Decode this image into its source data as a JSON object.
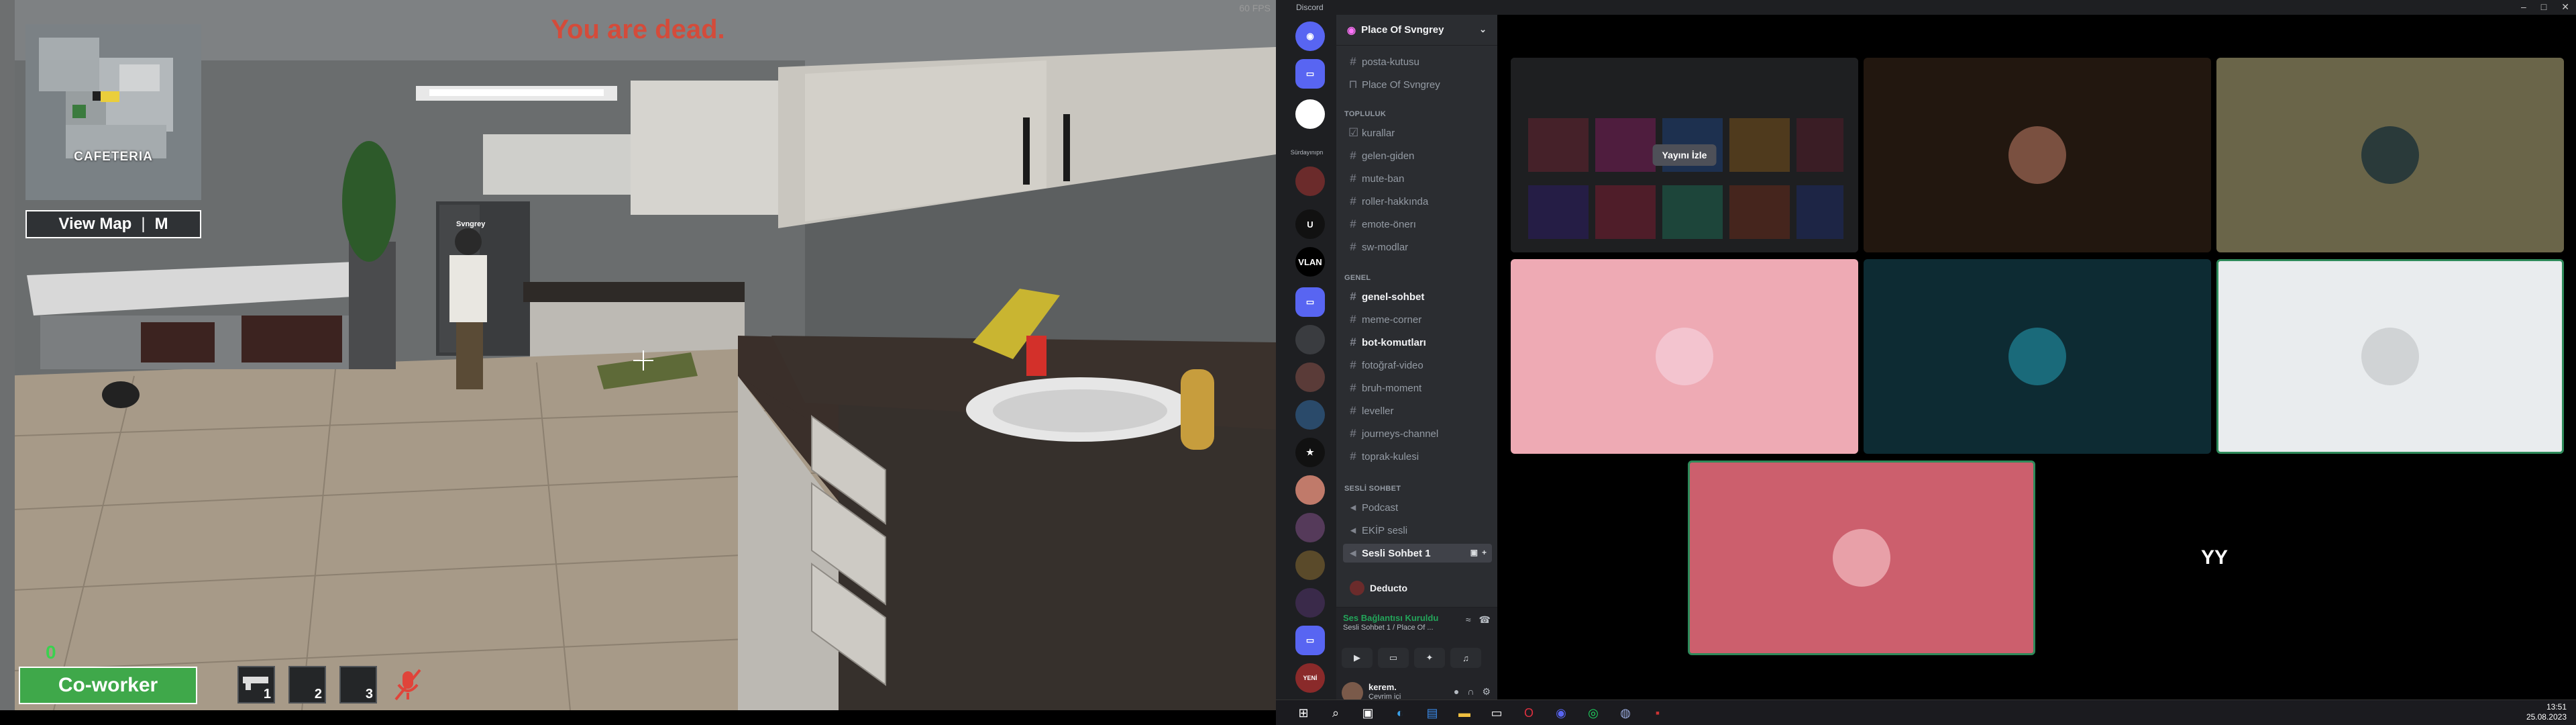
{
  "game": {
    "fps": "60 FPS",
    "death_message": "You are dead.",
    "minimap_label": "CAFETERIA",
    "view_map_label": "View Map",
    "view_map_key": "M",
    "nameplate": "Svngrey",
    "score": "0",
    "role": "Co-worker",
    "slots": [
      "1",
      "2",
      "3"
    ]
  },
  "discord": {
    "app_title": "Discord",
    "server_name": "Place Of Svngrey",
    "top_channels": [
      "posta-kutusu",
      "Place Of Svngrey"
    ],
    "categories": {
      "topluluk": "TOPLULUK",
      "genel": "GENEL",
      "sesli": "SESLİ SOHBET"
    },
    "topluluk_channels": [
      "kurallar",
      "gelen-giden",
      "mute-ban",
      "roller-hakkında",
      "emote-önerı",
      "sw-modlar"
    ],
    "genel_channels": [
      "genel-sohbet",
      "meme-corner",
      "bot-komutları",
      "fotoğraf-video",
      "bruh-moment",
      "leveller",
      "journeys-channel",
      "toprak-kulesi"
    ],
    "voice_channels": [
      "Podcast",
      "EKİP sesli",
      "Sesli Sohbet 1"
    ],
    "voice_user": "Deducto",
    "voice_status": "Ses Bağlantısı Kuruldu",
    "voice_location": "Sesli Sohbet 1 / Place Of ...",
    "user_name": "kerem.",
    "user_status": "Çevrim içi",
    "server_labels": [
      "Sürdayınıpn",
      "U",
      "VLAN",
      "YENİ"
    ],
    "watch_stream_label": "Yayını İzle",
    "yy_initials": "YY"
  },
  "taskbar": {
    "time": "13:51",
    "date": "25.08.2023"
  },
  "colors": {
    "death_red": "#d44b3a",
    "role_green": "#3fa84a",
    "voice_green": "#23a55a",
    "tile_pink": "#eeaab4",
    "tile_teal": "#0d2b33",
    "tile_white": "#e9ecee",
    "tile_olive": "#6a6549",
    "tile_brown": "#22170f",
    "tile_rose": "#cc5f6d"
  }
}
